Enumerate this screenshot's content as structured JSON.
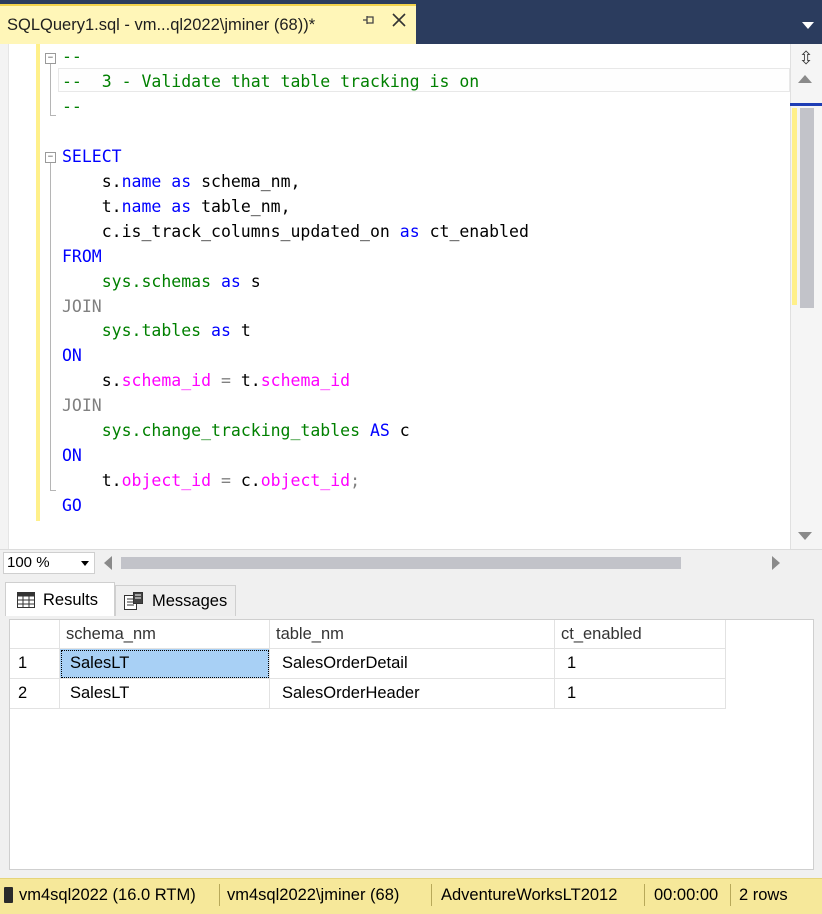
{
  "document_tab": {
    "title": "SQLQuery1.sql - vm...ql2022\\jminer (68))*",
    "pin_icon": "pin-icon",
    "close_icon": "close-icon"
  },
  "editor": {
    "lines": [
      {
        "tokens": [
          {
            "t": "--",
            "c": "cm"
          }
        ]
      },
      {
        "tokens": [
          {
            "t": "--  3 - Validate that table tracking is on",
            "c": "cm"
          }
        ]
      },
      {
        "tokens": [
          {
            "t": "--",
            "c": "cm"
          }
        ]
      },
      {
        "tokens": []
      },
      {
        "tokens": [
          {
            "t": "SELECT",
            "c": "kw"
          }
        ]
      },
      {
        "tokens": [
          {
            "t": "    s.",
            "c": ""
          },
          {
            "t": "name",
            "c": "kw"
          },
          {
            "t": " ",
            "c": ""
          },
          {
            "t": "as",
            "c": "kw"
          },
          {
            "t": " schema_nm,",
            "c": ""
          }
        ]
      },
      {
        "tokens": [
          {
            "t": "    t.",
            "c": ""
          },
          {
            "t": "name",
            "c": "kw"
          },
          {
            "t": " ",
            "c": ""
          },
          {
            "t": "as",
            "c": "kw"
          },
          {
            "t": " table_nm,",
            "c": ""
          }
        ]
      },
      {
        "tokens": [
          {
            "t": "    c.is_track_columns_updated_on ",
            "c": ""
          },
          {
            "t": "as",
            "c": "kw"
          },
          {
            "t": " ct_enabled",
            "c": ""
          }
        ]
      },
      {
        "tokens": [
          {
            "t": "FROM",
            "c": "kw"
          }
        ]
      },
      {
        "tokens": [
          {
            "t": "    ",
            "c": ""
          },
          {
            "t": "sys.schemas",
            "c": "ob"
          },
          {
            "t": " ",
            "c": ""
          },
          {
            "t": "as",
            "c": "kw"
          },
          {
            "t": " s",
            "c": ""
          }
        ]
      },
      {
        "tokens": [
          {
            "t": "JOIN",
            "c": "gy"
          }
        ]
      },
      {
        "tokens": [
          {
            "t": "    ",
            "c": ""
          },
          {
            "t": "sys.tables",
            "c": "ob"
          },
          {
            "t": " ",
            "c": ""
          },
          {
            "t": "as",
            "c": "kw"
          },
          {
            "t": " t",
            "c": ""
          }
        ]
      },
      {
        "tokens": [
          {
            "t": "ON",
            "c": "kw"
          }
        ]
      },
      {
        "tokens": [
          {
            "t": "    s.",
            "c": ""
          },
          {
            "t": "schema_id",
            "c": "fn"
          },
          {
            "t": " ",
            "c": ""
          },
          {
            "t": "=",
            "c": "gy"
          },
          {
            "t": " t.",
            "c": ""
          },
          {
            "t": "schema_id",
            "c": "fn"
          }
        ]
      },
      {
        "tokens": [
          {
            "t": "JOIN",
            "c": "gy"
          }
        ]
      },
      {
        "tokens": [
          {
            "t": "    ",
            "c": ""
          },
          {
            "t": "sys.change_tracking_tables",
            "c": "ob"
          },
          {
            "t": " ",
            "c": ""
          },
          {
            "t": "AS",
            "c": "kw"
          },
          {
            "t": " c",
            "c": ""
          }
        ]
      },
      {
        "tokens": [
          {
            "t": "ON",
            "c": "kw"
          }
        ]
      },
      {
        "tokens": [
          {
            "t": "    t.",
            "c": ""
          },
          {
            "t": "object_id",
            "c": "fn"
          },
          {
            "t": " ",
            "c": ""
          },
          {
            "t": "=",
            "c": "gy"
          },
          {
            "t": " c.",
            "c": ""
          },
          {
            "t": "object_id",
            "c": "fn"
          },
          {
            "t": ";",
            "c": "gy"
          }
        ]
      },
      {
        "tokens": [
          {
            "t": "GO",
            "c": "kw"
          }
        ]
      }
    ]
  },
  "zoom": {
    "value": "100 %"
  },
  "results_tabs": {
    "results_label": "Results",
    "messages_label": "Messages"
  },
  "grid": {
    "columns": [
      "schema_nm",
      "table_nm",
      "ct_enabled"
    ],
    "rows": [
      {
        "num": "1",
        "cells": [
          "SalesLT",
          "SalesOrderDetail",
          "1"
        ]
      },
      {
        "num": "2",
        "cells": [
          "SalesLT",
          "SalesOrderHeader",
          "1"
        ]
      }
    ]
  },
  "status": {
    "server": "vm4sql2022 (16.0 RTM)",
    "login": "vm4sql2022\\jminer (68)",
    "database": "AdventureWorksLT2012",
    "elapsed": "00:00:00",
    "rows": "2 rows"
  },
  "colors": {
    "keyword": "#0000ff",
    "comment": "#008000",
    "function": "#ff00ff",
    "operator": "#808080",
    "tab_background": "#fff6b8",
    "status_background": "#f6e89a",
    "selected_cell": "#a8d0f5"
  }
}
